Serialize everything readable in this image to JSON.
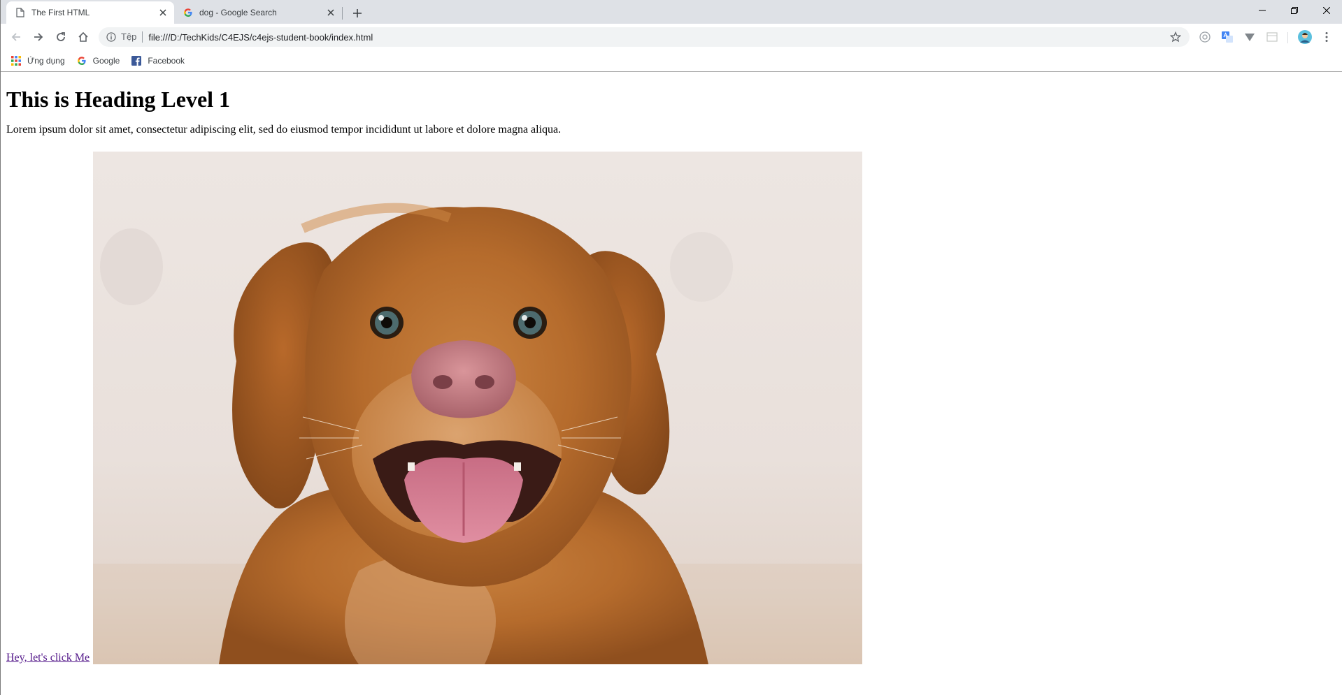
{
  "browser": {
    "tabs": [
      {
        "title": "The First HTML",
        "active": true,
        "icon": "page-icon"
      },
      {
        "title": "dog - Google Search",
        "active": false,
        "icon": "google-g-icon"
      }
    ],
    "omnibox": {
      "security_chip": "Tệp",
      "url": "file:///D:/TechKids/C4EJS/c4ejs-student-book/index.html"
    },
    "bookmarks": [
      {
        "label": "Ứng dụng",
        "icon": "apps-grid-icon"
      },
      {
        "label": "Google",
        "icon": "google-g-icon"
      },
      {
        "label": "Facebook",
        "icon": "facebook-icon"
      }
    ],
    "extensions": [
      "privacy-extension-icon",
      "translate-extension-icon",
      "vee-extension-icon",
      "blank-extension-icon"
    ]
  },
  "page": {
    "heading": "This is Heading Level 1",
    "paragraph": "Lorem ipsum dolor sit amet, consectetur adipiscing elit, sed do eiusmod tempor incididunt ut labore et dolore magna aliqua.",
    "link_text": "Hey, let's click Me",
    "image_subject": "dog-photo"
  },
  "colors": {
    "tabstrip_bg": "#dee1e6",
    "omnibox_bg": "#f1f3f4",
    "visited_link": "#551a8b",
    "google_blue": "#4285f4",
    "facebook_blue": "#3b5998"
  }
}
